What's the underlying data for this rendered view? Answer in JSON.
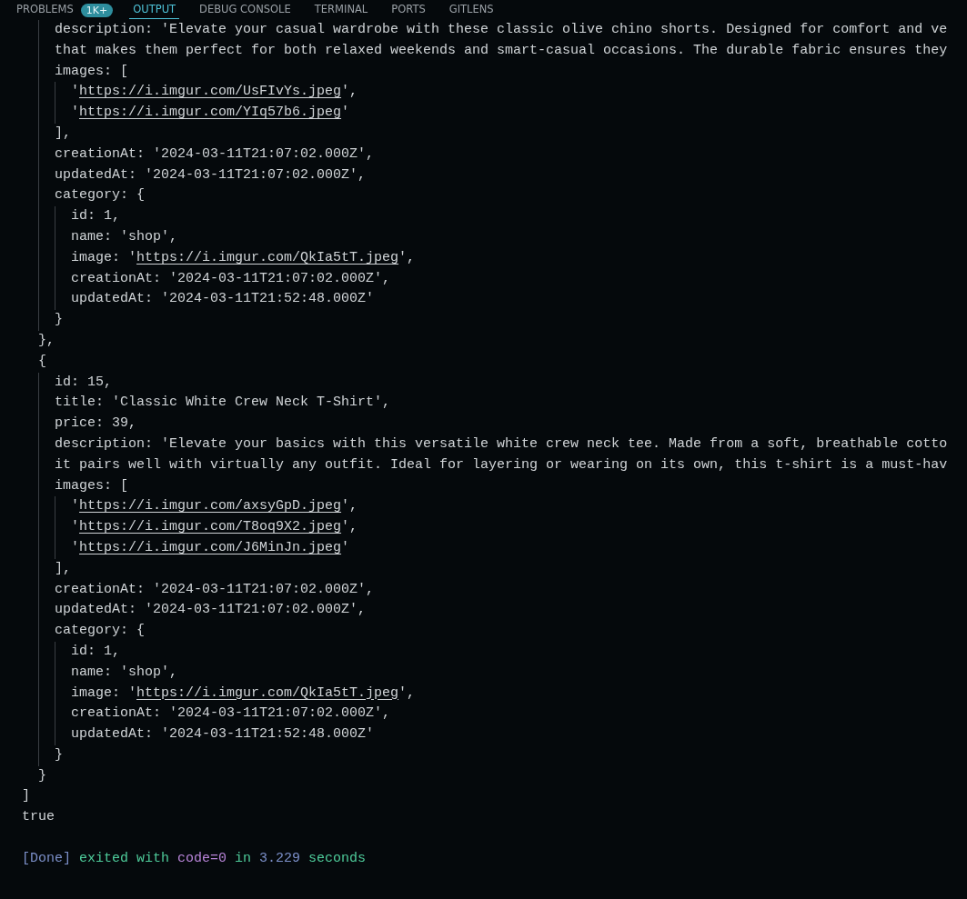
{
  "tabs": [
    {
      "label": "PROBLEMS",
      "selected": false,
      "badge": "1K+"
    },
    {
      "label": "OUTPUT",
      "selected": true
    },
    {
      "label": "DEBUG CONSOLE",
      "selected": false
    },
    {
      "label": "TERMINAL",
      "selected": false
    },
    {
      "label": "PORTS",
      "selected": false
    },
    {
      "label": "GITLENS",
      "selected": false
    }
  ],
  "output": [
    {
      "text": "    description: 'Elevate your casual wardrobe with these classic olive chino shorts. Designed for comfort and ve"
    },
    {
      "text": "    that makes them perfect for both relaxed weekends and smart-casual occasions. The durable fabric ensures they"
    },
    {
      "text": "    images: ["
    },
    {
      "kind": "url",
      "before": "      '",
      "url": "https://i.imgur.com/UsFIvYs.jpeg",
      "after": "',"
    },
    {
      "kind": "url",
      "before": "      '",
      "url": "https://i.imgur.com/YIq57b6.jpeg",
      "after": "'"
    },
    {
      "text": "    ],"
    },
    {
      "text": "    creationAt: '2024-03-11T21:07:02.000Z',"
    },
    {
      "text": "    updatedAt: '2024-03-11T21:07:02.000Z',"
    },
    {
      "text": "    category: {"
    },
    {
      "text": "      id: 1,"
    },
    {
      "text": "      name: 'shop',"
    },
    {
      "kind": "url",
      "before": "      image: '",
      "url": "https://i.imgur.com/QkIa5tT.jpeg",
      "after": "',"
    },
    {
      "text": "      creationAt: '2024-03-11T21:07:02.000Z',"
    },
    {
      "text": "      updatedAt: '2024-03-11T21:52:48.000Z'"
    },
    {
      "text": "    }"
    },
    {
      "text": "  },"
    },
    {
      "text": "  {"
    },
    {
      "text": "    id: 15,"
    },
    {
      "text": "    title: 'Classic White Crew Neck T-Shirt',"
    },
    {
      "text": "    price: 39,"
    },
    {
      "text": "    description: 'Elevate your basics with this versatile white crew neck tee. Made from a soft, breathable cotto"
    },
    {
      "text": "    it pairs well with virtually any outfit. Ideal for layering or wearing on its own, this t-shirt is a must-hav"
    },
    {
      "text": "    images: ["
    },
    {
      "kind": "url",
      "before": "      '",
      "url": "https://i.imgur.com/axsyGpD.jpeg",
      "after": "',"
    },
    {
      "kind": "url",
      "before": "      '",
      "url": "https://i.imgur.com/T8oq9X2.jpeg",
      "after": "',"
    },
    {
      "kind": "url",
      "before": "      '",
      "url": "https://i.imgur.com/J6MinJn.jpeg",
      "after": "'"
    },
    {
      "text": "    ],"
    },
    {
      "text": "    creationAt: '2024-03-11T21:07:02.000Z',"
    },
    {
      "text": "    updatedAt: '2024-03-11T21:07:02.000Z',"
    },
    {
      "text": "    category: {"
    },
    {
      "text": "      id: 1,"
    },
    {
      "text": "      name: 'shop',"
    },
    {
      "kind": "url",
      "before": "      image: '",
      "url": "https://i.imgur.com/QkIa5tT.jpeg",
      "after": "',"
    },
    {
      "text": "      creationAt: '2024-03-11T21:07:02.000Z',"
    },
    {
      "text": "      updatedAt: '2024-03-11T21:52:48.000Z'"
    },
    {
      "text": "    }"
    },
    {
      "text": "  }"
    },
    {
      "text": "]"
    },
    {
      "text": "true"
    }
  ],
  "done": [
    {
      "text": "[Done]",
      "color": "#7b8fc8"
    },
    {
      "text": "exited with",
      "color": "#4ecb9a"
    },
    {
      "text": "code=0",
      "color": "#b884d8"
    },
    {
      "text": "in",
      "color": "#4ecb9a"
    },
    {
      "text": "3.229",
      "color": "#7b8fc8"
    },
    {
      "text": "seconds",
      "color": "#4ecb9a"
    }
  ]
}
